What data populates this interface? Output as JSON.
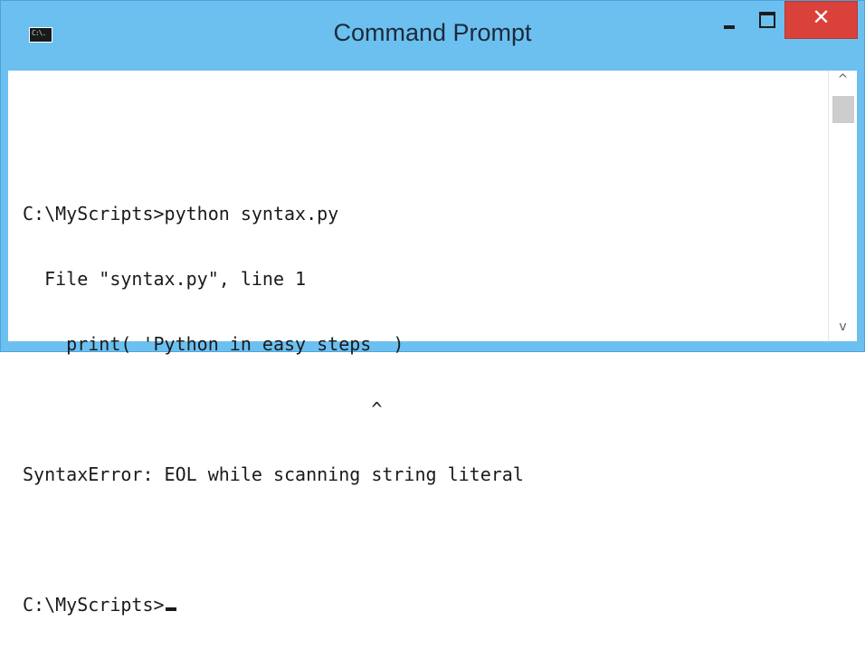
{
  "window": {
    "title": "Command Prompt",
    "icon": "cmd-icon",
    "icon_glyph": "C:\\.",
    "controls": {
      "minimize": "minimize-icon",
      "maximize": "maximize-icon",
      "close": "close-icon",
      "close_glyph": "✕"
    },
    "colors": {
      "titlebar": "#6cc0f0",
      "close_button": "#d9413a",
      "console_background": "#ffffff",
      "console_text": "#1a1a1a"
    }
  },
  "console": {
    "lines": [
      "",
      "C:\\MyScripts>python syntax.py",
      "  File \"syntax.py\", line 1",
      "    print( 'Python in easy steps  )",
      "                                ^",
      "SyntaxError: EOL while scanning string literal",
      "",
      "C:\\MyScripts>"
    ]
  },
  "scrollbar": {
    "up_glyph": "^",
    "down_glyph": "v"
  }
}
